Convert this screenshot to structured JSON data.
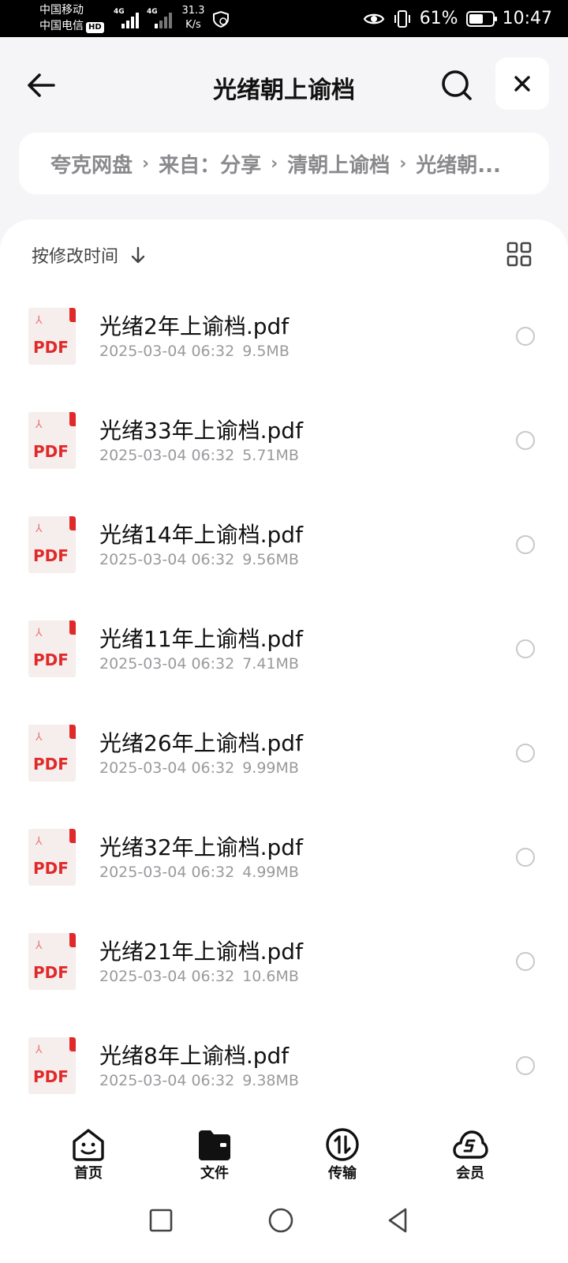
{
  "status_bar": {
    "carrier1": "中国移动",
    "carrier2": "中国电信",
    "hd": "HD",
    "net1": "4G",
    "net2": "4G",
    "speed_value": "31.3",
    "speed_unit": "K/s",
    "battery": "61%",
    "battery_level": 0.61,
    "time": "10:47"
  },
  "header": {
    "title": "光绪朝上谕档"
  },
  "breadcrumb": [
    "夸克网盘",
    "来自：分享",
    "清朝上谕档",
    "光绪朝..."
  ],
  "sort": {
    "label": "按修改时间"
  },
  "files": [
    {
      "name": "光绪2年上谕档.pdf",
      "date": "2025-03-04 06:32",
      "size": "9.5MB"
    },
    {
      "name": "光绪33年上谕档.pdf",
      "date": "2025-03-04 06:32",
      "size": "5.71MB"
    },
    {
      "name": "光绪14年上谕档.pdf",
      "date": "2025-03-04 06:32",
      "size": "9.56MB"
    },
    {
      "name": "光绪11年上谕档.pdf",
      "date": "2025-03-04 06:32",
      "size": "7.41MB"
    },
    {
      "name": "光绪26年上谕档.pdf",
      "date": "2025-03-04 06:32",
      "size": "9.99MB"
    },
    {
      "name": "光绪32年上谕档.pdf",
      "date": "2025-03-04 06:32",
      "size": "4.99MB"
    },
    {
      "name": "光绪21年上谕档.pdf",
      "date": "2025-03-04 06:32",
      "size": "10.6MB"
    },
    {
      "name": "光绪8年上谕档.pdf",
      "date": "2025-03-04 06:32",
      "size": "9.38MB"
    }
  ],
  "pdf_label": "PDF",
  "bottom_nav": [
    {
      "label": "首页",
      "icon": "home-smile-icon"
    },
    {
      "label": "文件",
      "icon": "folder-icon"
    },
    {
      "label": "传输",
      "icon": "transfer-icon"
    },
    {
      "label": "会员",
      "icon": "vip-cloud-icon"
    }
  ],
  "colors": {
    "pdf_red": "#e02a2a",
    "background": "#f5f5f7",
    "secondary_text": "#9a9a9e"
  }
}
